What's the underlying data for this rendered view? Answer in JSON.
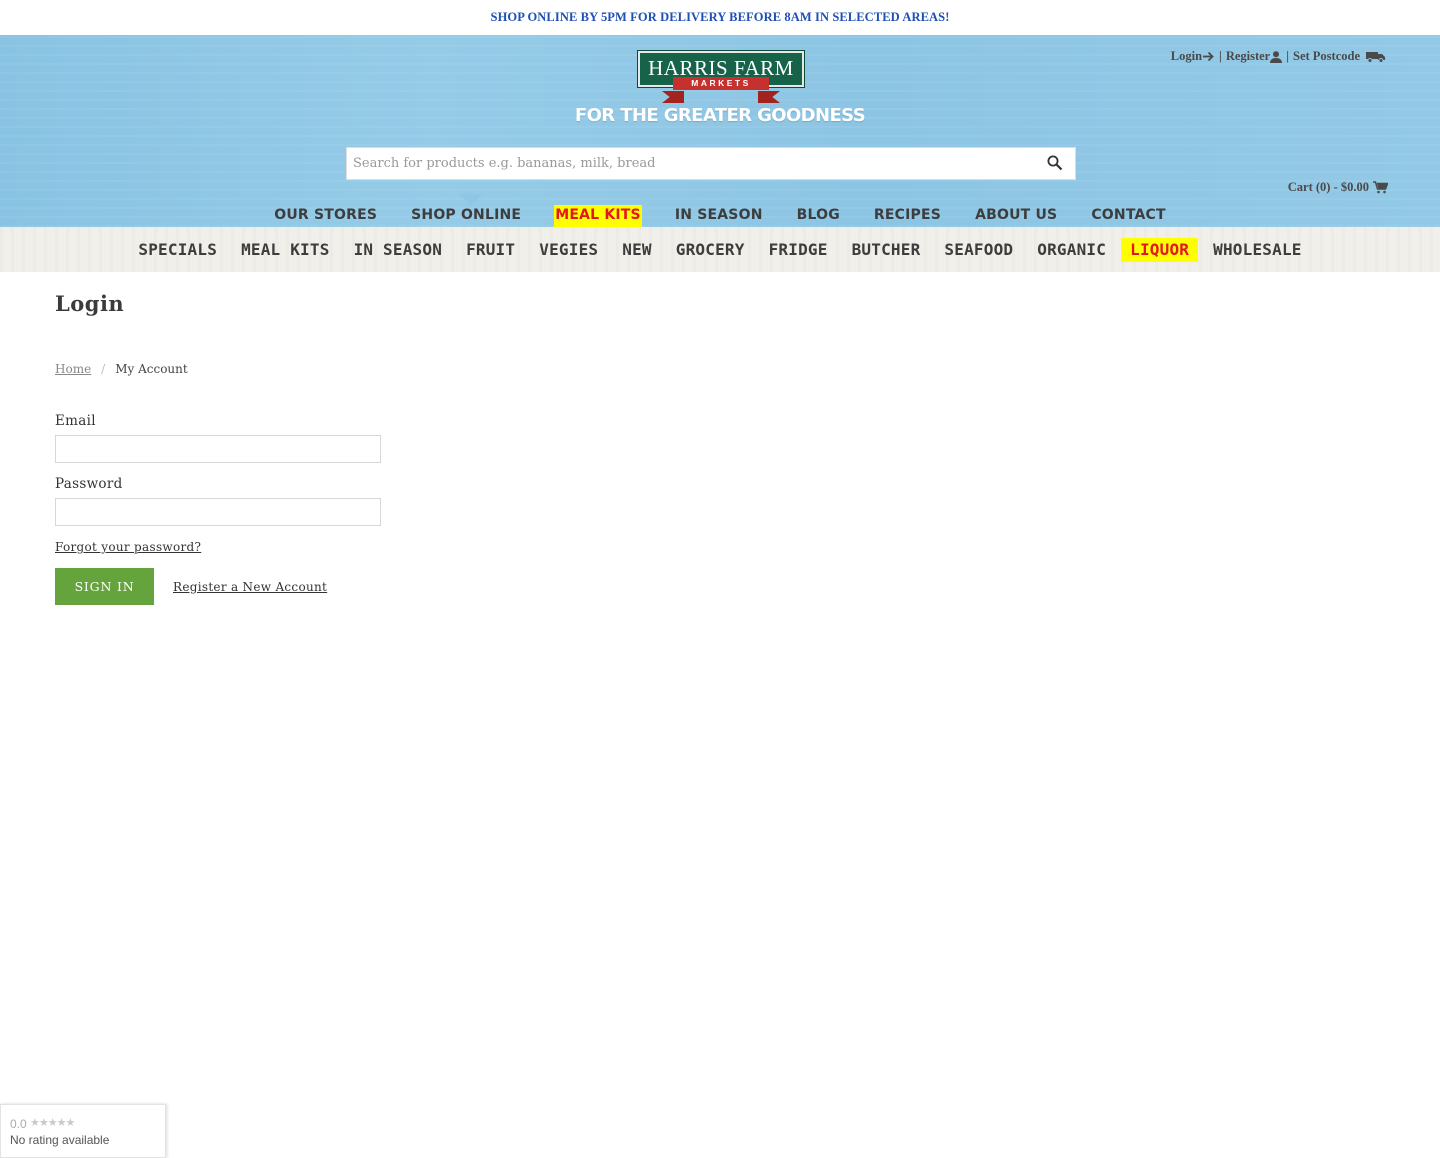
{
  "announcement": "SHOP ONLINE BY 5PM FOR DELIVERY BEFORE 8AM IN SELECTED AREAS!",
  "logo": {
    "name": "HARRIS FARM",
    "sub": "MARKETS"
  },
  "tagline": "FOR THE GREATER GOODNESS",
  "account": {
    "login": "Login",
    "sep1": "|",
    "register": "Register",
    "sep2": "|",
    "postcode": "Set Postcode"
  },
  "search": {
    "placeholder": "Search for products e.g. bananas, milk, bread"
  },
  "cart": {
    "label": "Cart (0) - $0.00"
  },
  "main_nav": [
    {
      "label": "Our Stores",
      "highlight": false
    },
    {
      "label": "Shop Online",
      "highlight": false,
      "active": true
    },
    {
      "label": "Meal Kits",
      "highlight": true
    },
    {
      "label": "In Season",
      "highlight": false
    },
    {
      "label": "Blog",
      "highlight": false
    },
    {
      "label": "Recipes",
      "highlight": false
    },
    {
      "label": "About Us",
      "highlight": false
    },
    {
      "label": "Contact",
      "highlight": false
    }
  ],
  "sub_nav": [
    {
      "label": "Specials"
    },
    {
      "label": "Meal Kits"
    },
    {
      "label": "In Season"
    },
    {
      "label": "Fruit"
    },
    {
      "label": "Vegies"
    },
    {
      "label": "New"
    },
    {
      "label": "Grocery"
    },
    {
      "label": "Fridge"
    },
    {
      "label": "Butcher"
    },
    {
      "label": "Seafood"
    },
    {
      "label": "Organic"
    },
    {
      "label": "Liquor",
      "highlight": true
    },
    {
      "label": "Wholesale"
    }
  ],
  "page": {
    "title": "Login",
    "breadcrumb": {
      "home": "Home",
      "sep": "/",
      "current": "My Account"
    }
  },
  "form": {
    "email_label": "Email",
    "email_value": "",
    "password_label": "Password",
    "password_value": "",
    "forgot": "Forgot your password?",
    "submit": "SIGN IN",
    "register": "Register a New Account"
  },
  "rating_badge": {
    "score": "0.0",
    "stars": "★★★★★",
    "text": "No rating available"
  },
  "colors": {
    "announcement": "#1e4fb3",
    "header_bg": "#8ec6e4",
    "logo_green": "#17634a",
    "logo_red": "#c6312d",
    "highlight_bg": "#ffff00",
    "highlight_text": "#e4171e",
    "button": "#65a33c"
  },
  "icons": {
    "login": "arrow-right-icon",
    "register": "user-icon",
    "postcode": "truck-icon",
    "search": "magnifier-icon",
    "cart": "cart-icon"
  }
}
